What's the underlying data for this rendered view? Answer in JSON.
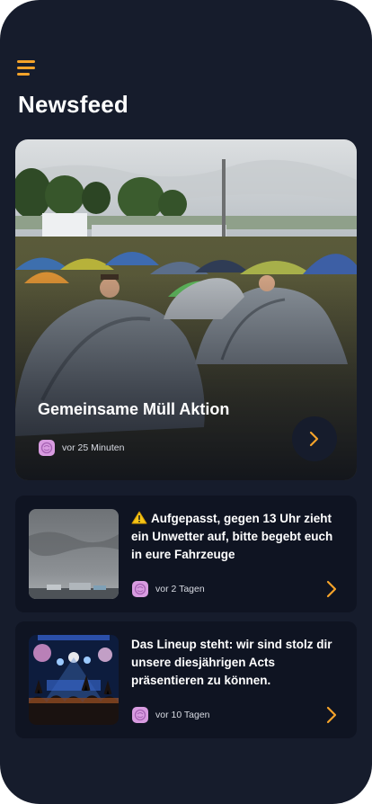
{
  "header": {
    "title": "Newsfeed",
    "menu_icon": "hamburger-menu-icon"
  },
  "colors": {
    "background": "#161c2c",
    "card": "#0f1422",
    "accent": "#f5a32a",
    "avatar": "#d89be0"
  },
  "featured": {
    "title": "Gemeinsame Müll Aktion",
    "time": "vor 25 Minuten",
    "image": "festival campsite with grey tents",
    "arrow_icon": "chevron-right-icon"
  },
  "news": [
    {
      "icon": "warning-icon",
      "title": "Aufgepasst, gegen 13 Uhr zieht ein Unwetter auf, bitte begebt euch in eure Fahrzeuge",
      "time": "vor 2 Tagen",
      "image": "stormy grey sky over festival"
    },
    {
      "title": "Das Lineup steht: wir sind stolz dir unsere diesjährigen Acts präsentieren zu können.",
      "time": "vor 10 Tagen",
      "image": "concert crowd with stage lights"
    }
  ]
}
